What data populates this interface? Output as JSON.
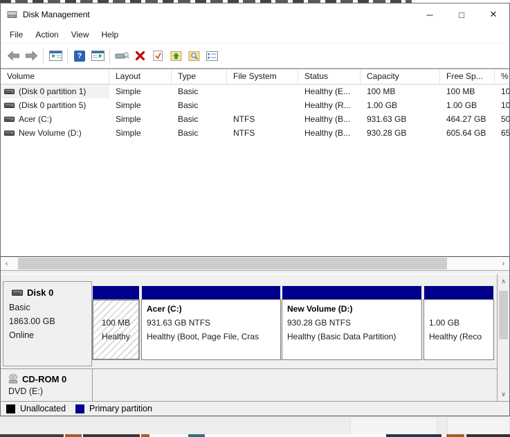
{
  "titlebar": {
    "title": "Disk Management",
    "controls": {
      "minimize": "─",
      "maximize": "□",
      "close": "✕"
    }
  },
  "menu": {
    "items": [
      "File",
      "Action",
      "View",
      "Help"
    ]
  },
  "toolbar": {
    "icons": [
      "back",
      "forward",
      "show-console-tree",
      "help",
      "show-action-pane",
      "rescan-disks",
      "delete",
      "check-status",
      "folder-up",
      "folder-search",
      "view-options"
    ],
    "help_glyph": "?"
  },
  "glyphs": {
    "scroll_left": "‹",
    "scroll_right": "›",
    "scroll_up": "∧",
    "scroll_down": "∨"
  },
  "table": {
    "columns": [
      "Volume",
      "Layout",
      "Type",
      "File System",
      "Status",
      "Capacity",
      "Free Sp...",
      "%"
    ],
    "rows": [
      {
        "volume": "(Disk 0 partition 1)",
        "layout": "Simple",
        "type": "Basic",
        "fs": "",
        "status": "Healthy (E...",
        "capacity": "100 MB",
        "free": "100 MB",
        "pct": "10"
      },
      {
        "volume": "(Disk 0 partition 5)",
        "layout": "Simple",
        "type": "Basic",
        "fs": "",
        "status": "Healthy (R...",
        "capacity": "1.00 GB",
        "free": "1.00 GB",
        "pct": "10"
      },
      {
        "volume": "Acer (C:)",
        "layout": "Simple",
        "type": "Basic",
        "fs": "NTFS",
        "status": "Healthy (B...",
        "capacity": "931.63 GB",
        "free": "464.27 GB",
        "pct": "50"
      },
      {
        "volume": "New Volume (D:)",
        "layout": "Simple",
        "type": "Basic",
        "fs": "NTFS",
        "status": "Healthy (B...",
        "capacity": "930.28 GB",
        "free": "605.64 GB",
        "pct": "65"
      }
    ]
  },
  "disk0": {
    "label": {
      "name": "Disk 0",
      "type": "Basic",
      "size": "1863.00 GB",
      "status": "Online"
    },
    "partitions": [
      {
        "name": "",
        "size": "100 MB",
        "status": "Healthy"
      },
      {
        "name": "Acer (C:)",
        "size": "931.63 GB NTFS",
        "status": "Healthy (Boot, Page File, Cras"
      },
      {
        "name": "New Volume (D:)",
        "size": "930.28 GB NTFS",
        "status": "Healthy (Basic Data Partition)"
      },
      {
        "name": "",
        "size": "1.00 GB",
        "status": "Healthy (Reco"
      }
    ]
  },
  "cdrom": {
    "name": "CD-ROM 0",
    "drive": "DVD (E:)"
  },
  "legend": {
    "items": [
      {
        "label": "Unallocated",
        "color": "#000000"
      },
      {
        "label": "Primary partition",
        "color": "#00008b"
      }
    ]
  },
  "colors": {
    "partition_bar": "#00008b",
    "pane_bg": "#f0f0f0",
    "hatch_gray": "#dcdcdc"
  }
}
